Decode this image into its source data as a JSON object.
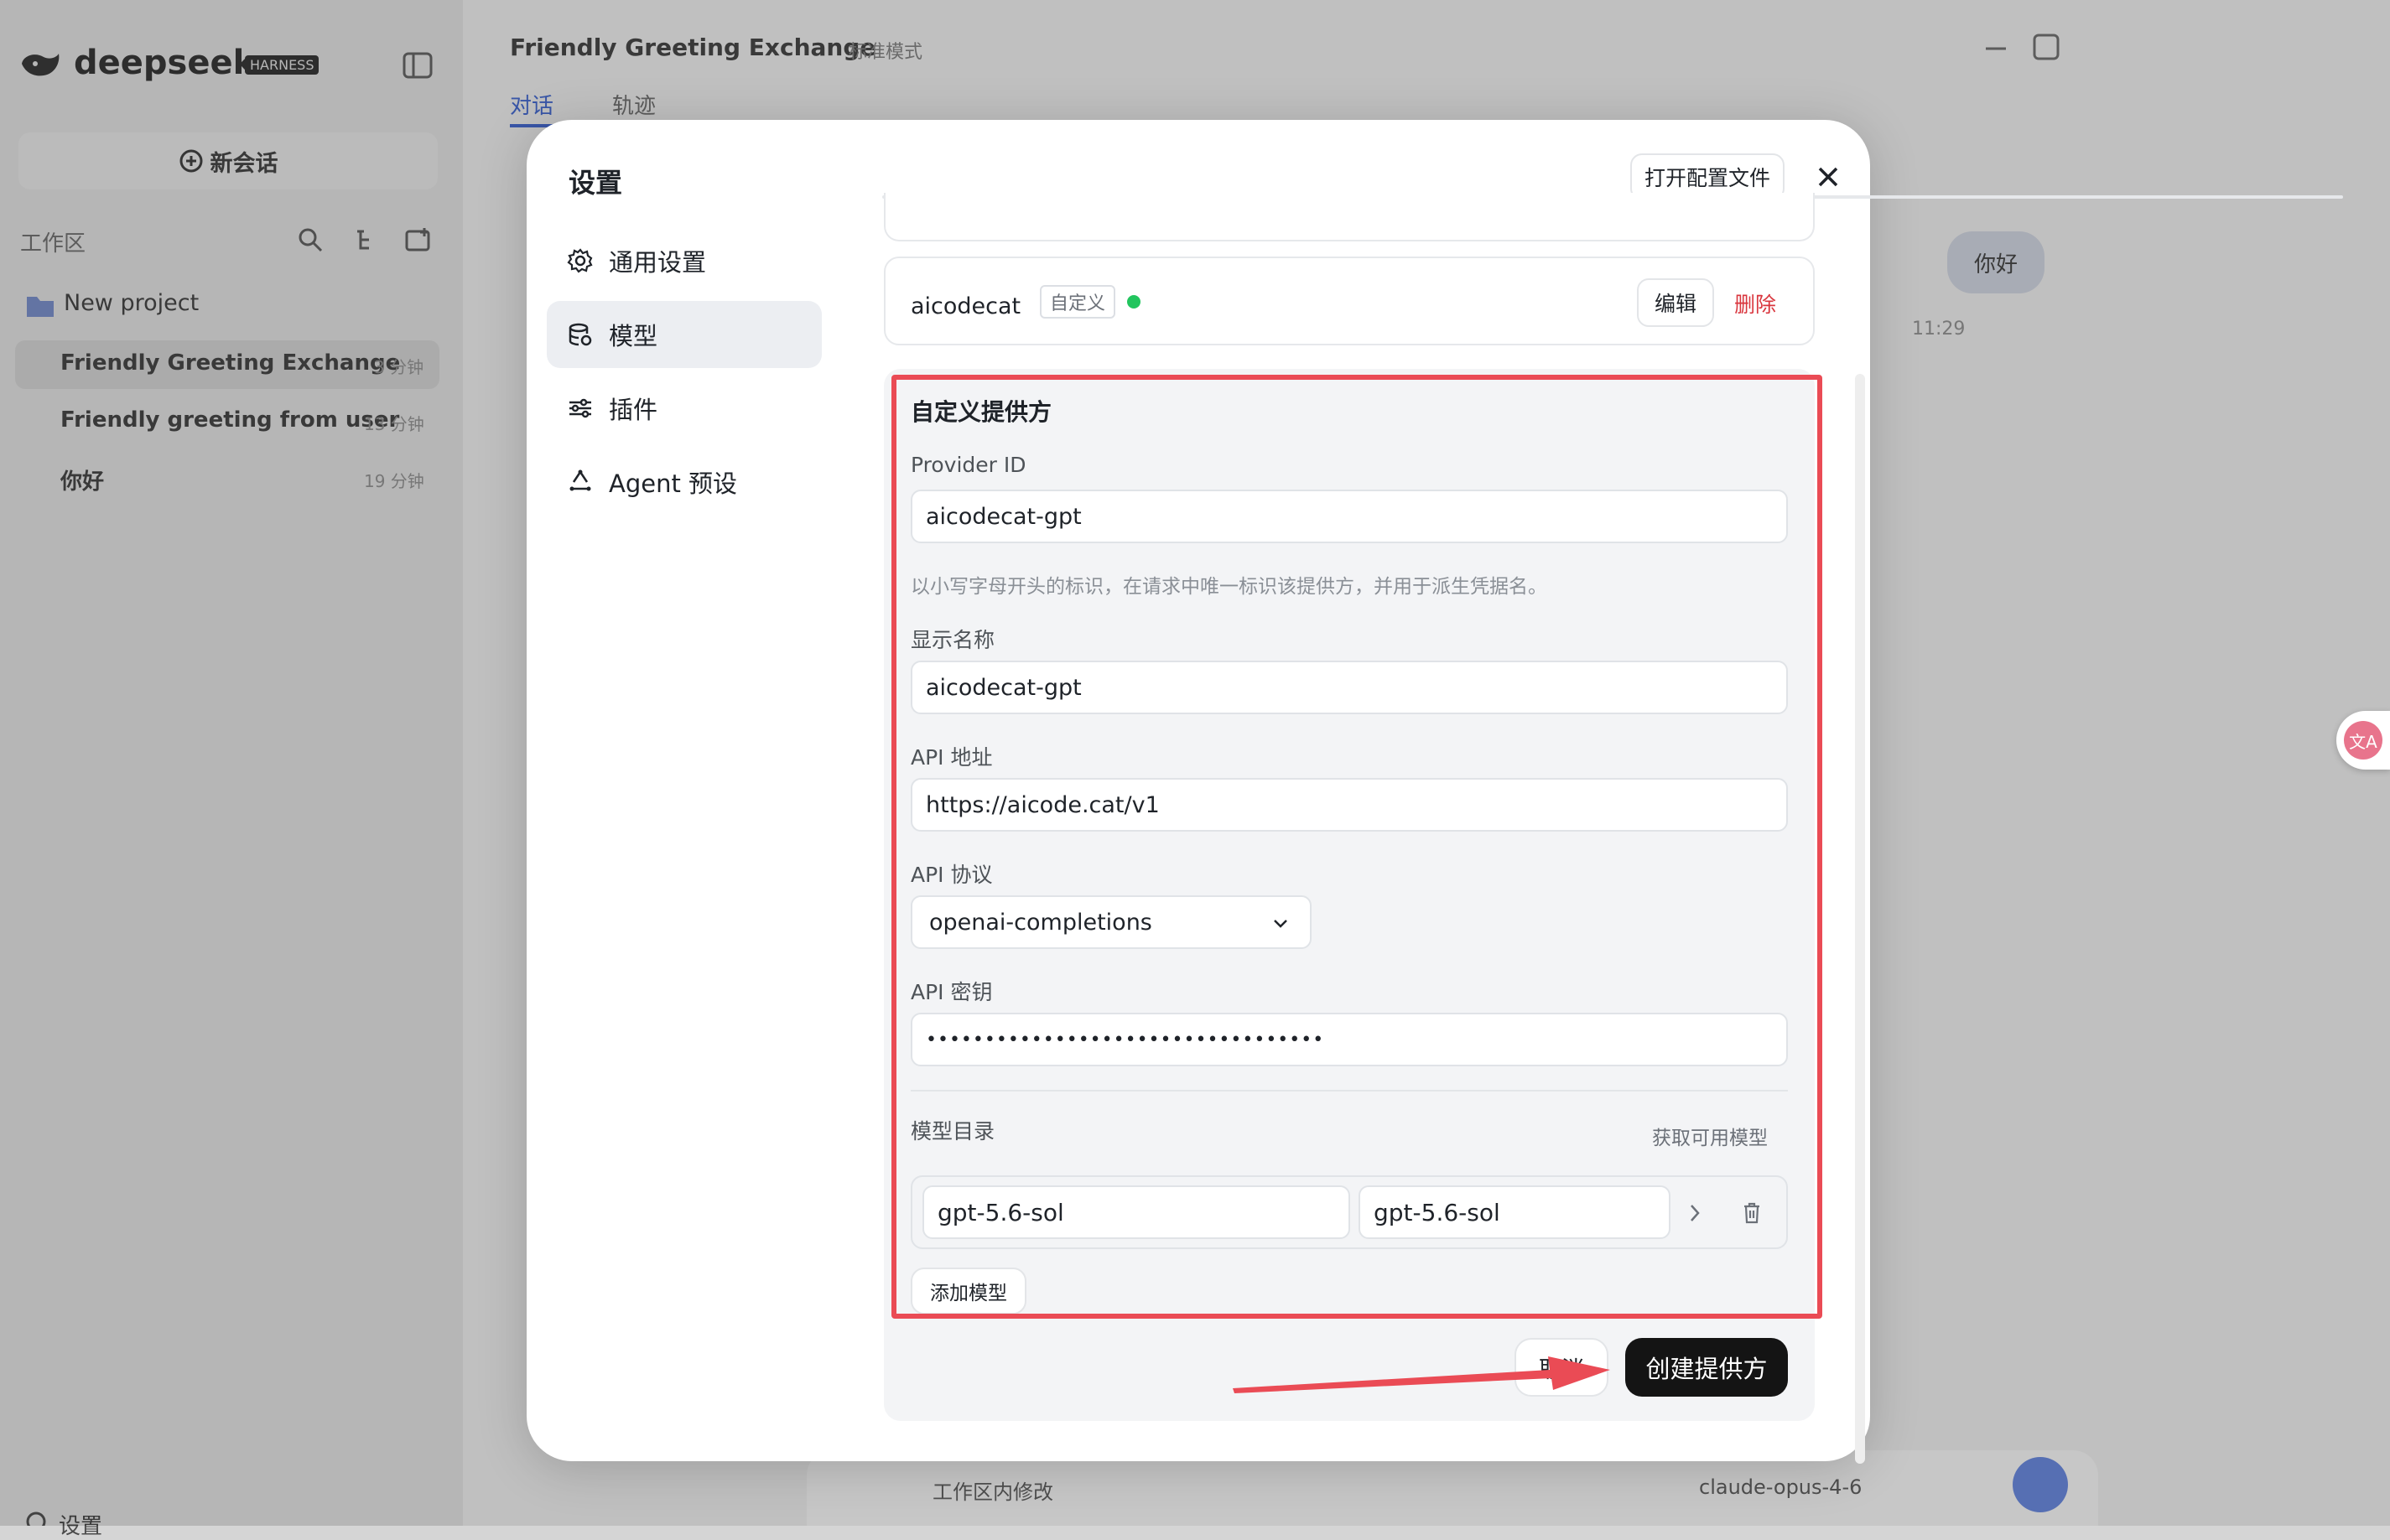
{
  "background": {
    "logo_text": "deepseek",
    "logo_badge": "HARNESS",
    "new_chat_label": "新会话",
    "workspace_label": "工作区",
    "project_name": "New project",
    "conversations": [
      {
        "title": "Friendly Greeting Exchange",
        "time": "3 分钟"
      },
      {
        "title": "Friendly greeting from user",
        "time": "13 分钟"
      },
      {
        "title": "你好",
        "time": "19 分钟"
      }
    ],
    "settings_label": "设置",
    "header_title": "Friendly Greeting Exchange",
    "header_mode": "标准模式",
    "tabs": [
      "对话",
      "轨迹"
    ],
    "chat_bubble": "你好",
    "chat_time": "11:29",
    "composer_workspace": "工作区内修改",
    "composer_model": "claude-opus-4-6"
  },
  "modal": {
    "title": "设置",
    "open_config_label": "打开配置文件",
    "nav": [
      {
        "label": "通用设置",
        "icon": "gear-icon"
      },
      {
        "label": "模型",
        "icon": "database-icon"
      },
      {
        "label": "插件",
        "icon": "sliders-icon"
      },
      {
        "label": "Agent 预设",
        "icon": "recycle-icon"
      }
    ],
    "provider_card": {
      "name": "aicodecat",
      "tag": "自定义",
      "status_color": "#22c55e",
      "edit_label": "编辑",
      "delete_label": "删除"
    },
    "form": {
      "section_title": "自定义提供方",
      "provider_id_label": "Provider ID",
      "provider_id_value": "aicodecat-gpt",
      "provider_id_hint": "以小写字母开头的标识，在请求中唯一标识该提供方，并用于派生凭据名。",
      "display_name_label": "显示名称",
      "display_name_value": "aicodecat-gpt",
      "api_url_label": "API 地址",
      "api_url_value": "https://aicode.cat/v1",
      "api_protocol_label": "API 协议",
      "api_protocol_value": "openai-completions",
      "api_key_label": "API 密钥",
      "api_key_value": "••••••••••••••••••••••••••••••••••",
      "catalog_label": "模型目录",
      "fetch_models_label": "获取可用模型",
      "models": [
        {
          "id": "gpt-5.6-sol",
          "name": "gpt-5.6-sol"
        }
      ],
      "add_model_label": "添加模型",
      "cancel_label": "取消",
      "create_label": "创建提供方"
    },
    "highlight_color": "#ea4b55"
  }
}
